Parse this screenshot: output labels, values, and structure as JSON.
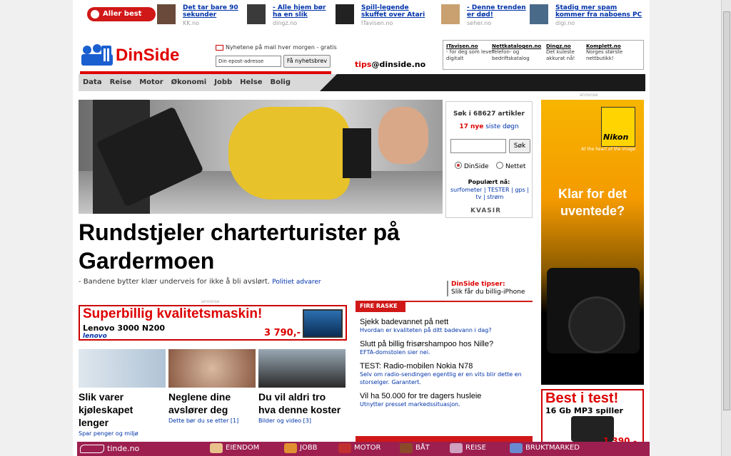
{
  "topstrip": {
    "best_label": "Aller best nå:",
    "items": [
      {
        "title": "Det tar bare 90 sekunder",
        "source": "KK.no"
      },
      {
        "title": "- Alle hjem bør ha en slik",
        "source": "dingz.no"
      },
      {
        "title": "Spill-legende skuffet over Atari",
        "source": "ITavisen.no"
      },
      {
        "title": "- Denne trenden er død!",
        "source": "seher.no"
      },
      {
        "title": "Stadig mer spam kommer fra naboens PC",
        "source": "digi.no"
      }
    ]
  },
  "header": {
    "logo_text": "DinSide",
    "newsletter_label": "Nyhetene på mail hver morgen - gratis",
    "newsletter_placeholder": "Din epost-adresse",
    "newsletter_button": "Få nyhetsbrev",
    "tips_prefix": "tips",
    "tips_suffix": "@dinside.no",
    "partners": [
      {
        "name": "ITavisen.no",
        "desc": "- for deg som lever digitalt"
      },
      {
        "name": "Nettkatalogen.no",
        "desc": "Telefon- og bedriftskatalog"
      },
      {
        "name": "Dingz.no",
        "desc": "Det kuleste akkurat nå!"
      },
      {
        "name": "Komplett.no",
        "desc": "Norges største nettbutikk!"
      }
    ]
  },
  "nav": [
    "Data",
    "Reise",
    "Motor",
    "Økonomi",
    "Jobb",
    "Helse",
    "Bolig"
  ],
  "main": {
    "headline": "Rundstjeler charterturister på Gardermoen",
    "lead": "- Bandene bytter klær underveis for ikke å bli avslørt.",
    "lead_link": "Politiet advarer"
  },
  "search": {
    "title": "Søk i 68627 artikler",
    "new_count": "17 nye",
    "new_suffix": "siste døgn",
    "button": "Søk",
    "radio_1": "DinSide",
    "radio_2": "Nettet",
    "popular_label": "Populært nå:",
    "popular_links": "surfometer | TESTER | gps | tv | strøm",
    "brand": "KVASIR"
  },
  "tipser": {
    "title": "DinSide tipser:",
    "text": "Slik får du billig-iPhone"
  },
  "ads": {
    "annonse": "annonse",
    "nikon_brand": "Nikon",
    "nikon_tag": "At the heart of the image",
    "nikon_text": "Klar for det uventede?",
    "superbillig_title": "Superbillig kvalitetsmaskin!",
    "superbillig_model": "Lenovo 3000 N200",
    "superbillig_brand": "lenovo",
    "superbillig_price": "3 790,-",
    "besttest_title": "Best i test!",
    "besttest_sub": "16 Gb MP3 spiller",
    "besttest_price": "1 390,-"
  },
  "stories": [
    {
      "title": "Slik varer kjøleskapet lenger",
      "meta": "Spar penger og miljø"
    },
    {
      "title": "Neglene dine avslører deg",
      "meta": "Dette bør du se etter [1]"
    },
    {
      "title": "Du vil aldri tro hva denne koster",
      "meta": "Bilder og video [3]"
    }
  ],
  "fire_raske": {
    "label": "FIRE RASKE",
    "items": [
      {
        "title": "Sjekk badevannet på nett",
        "desc": "Hvordan er kvaliteten på ditt badevann i dag?"
      },
      {
        "title": "Slutt på billig frisørshampoo hos Nille?",
        "desc": "EFTA-domstolen sier nei."
      },
      {
        "title": "TEST: Radio-mobilen Nokia N78",
        "desc": "Selv om radio-sendingen egentlig er en vits blir dette en storselger. Garantert."
      },
      {
        "title": "Vil ha 50.000 for tre dagers husleie",
        "desc": "Utnytter presset markedssituasjon."
      }
    ]
  },
  "bottombar": {
    "logo": "tinde.no",
    "items": [
      "EIENDOM",
      "JOBB",
      "MOTOR",
      "BÅT",
      "REISE",
      "BRUKTMARKED"
    ]
  }
}
